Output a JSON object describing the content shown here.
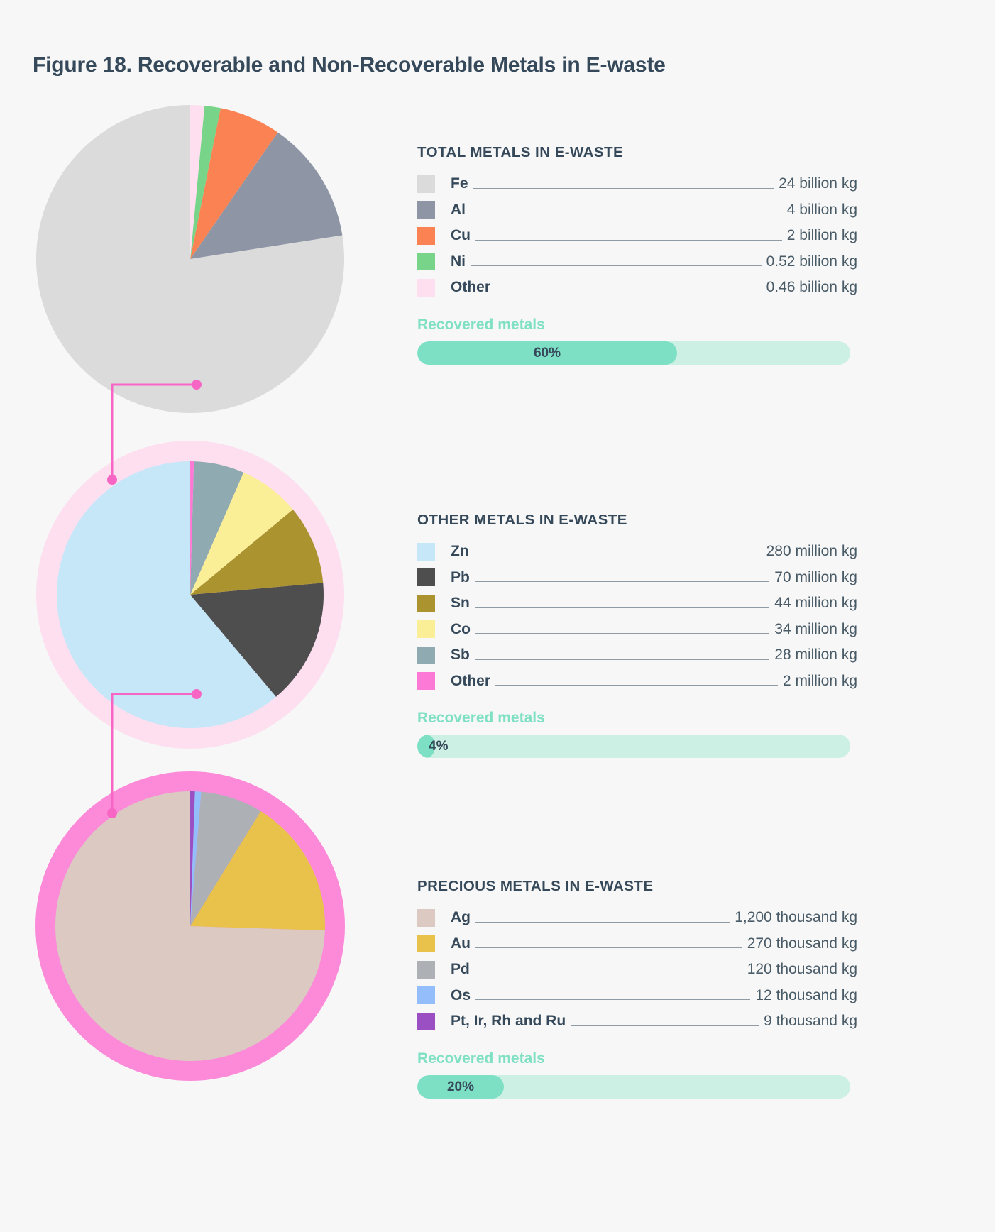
{
  "figure": {
    "title": "Figure 18. Recoverable and Non-Recoverable Metals in E-waste",
    "background": "#f6f7f6",
    "text_color": "#36495a",
    "connector_color": "#f766c4",
    "recovered_label_color": "#7fe0c4"
  },
  "blocks": [
    {
      "title": "TOTAL METALS IN E-WASTE",
      "recovered_label": "Recovered metals",
      "recovered_percent_text": "60%",
      "recovered_percent": 60,
      "ring_color": null,
      "items": [
        {
          "label": "Fe",
          "value": "24 billion kg",
          "color": "#dcdbdb",
          "amount": 24
        },
        {
          "label": "Al",
          "value": "4 billion kg",
          "color": "#8e96a6",
          "amount": 4
        },
        {
          "label": "Cu",
          "value": "2 billion kg",
          "color": "#fb8353",
          "amount": 2
        },
        {
          "label": "Ni",
          "value": "0.52 billion kg",
          "color": "#77d489",
          "amount": 0.52
        },
        {
          "label": "Other",
          "value": "0.46 billion kg",
          "color": "#fddff0",
          "amount": 0.46
        }
      ]
    },
    {
      "title": "OTHER METALS IN E-WASTE",
      "recovered_label": "Recovered metals",
      "recovered_percent_text": "4%",
      "recovered_percent": 4,
      "ring_color": "#fddff0",
      "items": [
        {
          "label": "Zn",
          "value": "280 million kg",
          "color": "#c5e7f8",
          "amount": 280
        },
        {
          "label": "Pb",
          "value": "70 million kg",
          "color": "#4e4e4e",
          "amount": 70
        },
        {
          "label": "Sn",
          "value": "44 million kg",
          "color": "#ab9330",
          "amount": 44
        },
        {
          "label": "Co",
          "value": "34 million kg",
          "color": "#faef97",
          "amount": 34
        },
        {
          "label": "Sb",
          "value": "28 million kg",
          "color": "#90aab2",
          "amount": 28
        },
        {
          "label": "Other",
          "value": "2 million kg",
          "color": "#fc79d5",
          "amount": 2
        }
      ]
    },
    {
      "title": "PRECIOUS METALS IN E-WASTE",
      "recovered_label": "Recovered metals",
      "recovered_percent_text": "20%",
      "recovered_percent": 20,
      "ring_color": "#fc8ad9",
      "items": [
        {
          "label": "Ag",
          "value": "1,200 thousand kg",
          "color": "#dbc9c2",
          "amount": 1200
        },
        {
          "label": "Au",
          "value": "270 thousand kg",
          "color": "#e8c24b",
          "amount": 270
        },
        {
          "label": "Pd",
          "value": "120 thousand kg",
          "color": "#adb0b5",
          "amount": 120
        },
        {
          "label": "Os",
          "value": "12 thousand kg",
          "color": "#93befb",
          "amount": 12
        },
        {
          "label": "Pt, Ir, Rh and Ru",
          "value": "9 thousand kg",
          "color": "#9a4fc2",
          "amount": 9
        }
      ]
    }
  ],
  "chart_data": [
    {
      "type": "pie",
      "title": "TOTAL METALS IN E-WASTE",
      "categories": [
        "Fe",
        "Al",
        "Cu",
        "Ni",
        "Other"
      ],
      "values": [
        24,
        4,
        2,
        0.52,
        0.46
      ],
      "unit": "billion kg",
      "colors": [
        "#dcdbdb",
        "#8e96a6",
        "#fb8353",
        "#77d489",
        "#fddff0"
      ],
      "legend": "right",
      "annotation": "Recovered metals 60%"
    },
    {
      "type": "pie",
      "title": "OTHER METALS IN E-WASTE",
      "categories": [
        "Zn",
        "Pb",
        "Sn",
        "Co",
        "Sb",
        "Other"
      ],
      "values": [
        280,
        70,
        44,
        34,
        28,
        2
      ],
      "unit": "million kg",
      "colors": [
        "#c5e7f8",
        "#4e4e4e",
        "#ab9330",
        "#faef97",
        "#90aab2",
        "#fc79d5"
      ],
      "legend": "right",
      "annotation": "Recovered metals 4%"
    },
    {
      "type": "pie",
      "title": "PRECIOUS METALS IN E-WASTE",
      "categories": [
        "Ag",
        "Au",
        "Pd",
        "Os",
        "Pt, Ir, Rh and Ru"
      ],
      "values": [
        1200,
        270,
        120,
        12,
        9
      ],
      "unit": "thousand kg",
      "colors": [
        "#dbc9c2",
        "#e8c24b",
        "#adb0b5",
        "#93befb",
        "#9a4fc2"
      ],
      "legend": "right",
      "annotation": "Recovered metals 20%"
    }
  ]
}
